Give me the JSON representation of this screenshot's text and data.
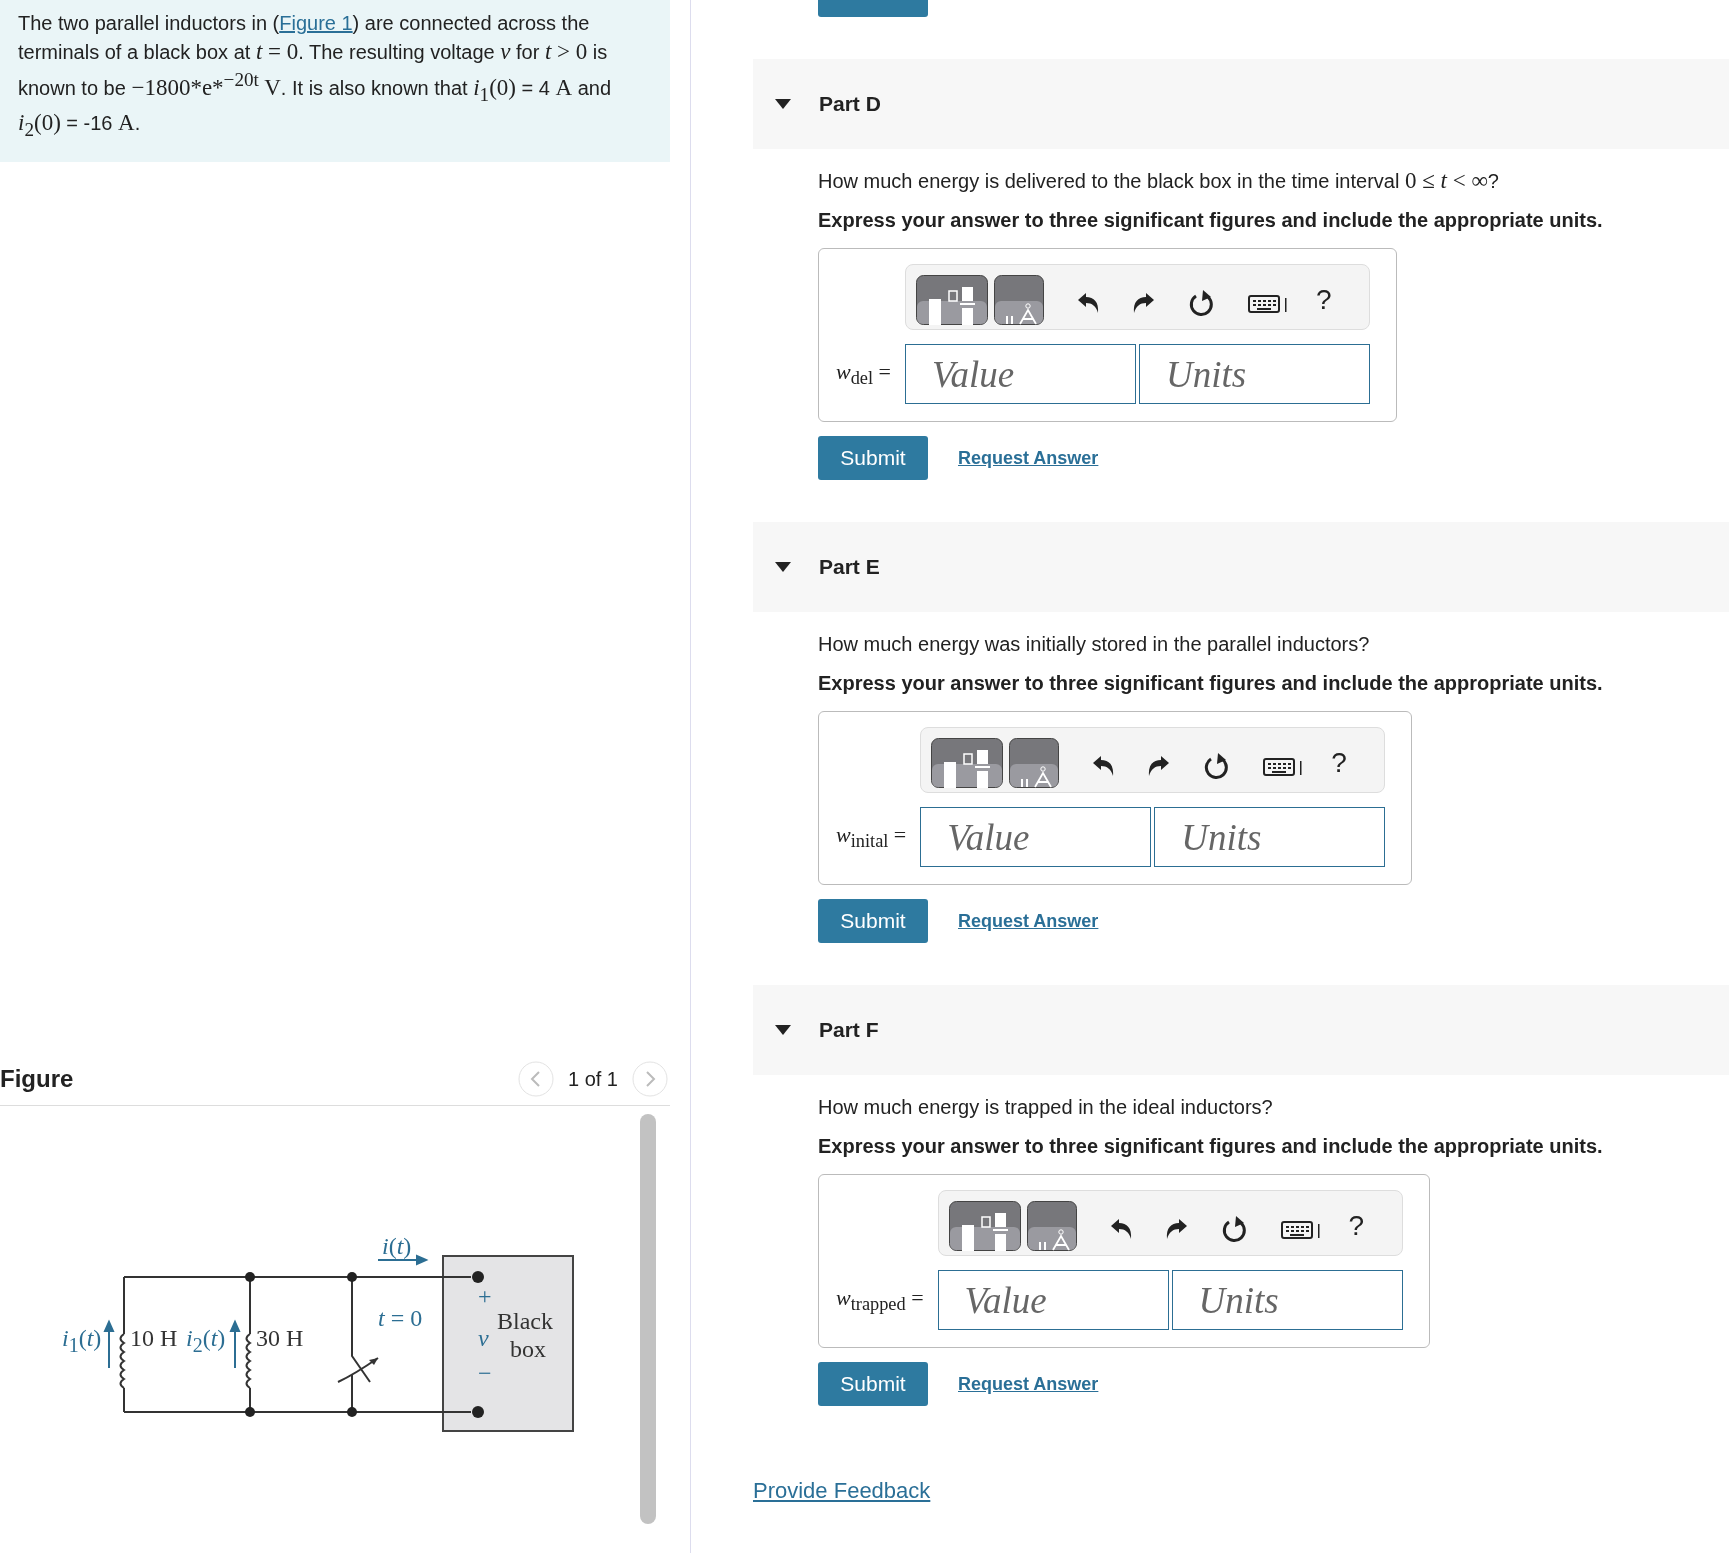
{
  "problem": {
    "segments": [
      {
        "kind": "text",
        "text": "The two parallel inductors in ("
      },
      {
        "kind": "link",
        "text": "Figure 1"
      },
      {
        "kind": "text",
        "text": ") are connected across the terminals of a black box at "
      },
      {
        "kind": "math",
        "text": "*t* = 0"
      },
      {
        "kind": "text",
        "text": ". The resulting voltage "
      },
      {
        "kind": "math",
        "text": "*v*"
      },
      {
        "kind": "text",
        "text": " for "
      },
      {
        "kind": "math",
        "text": "*t* > 0"
      },
      {
        "kind": "text",
        "text": " is known to be "
      },
      {
        "kind": "math",
        "text": "−1800*e*$^{−20t}$ V"
      },
      {
        "kind": "text",
        "text": ". It is also known that "
      },
      {
        "kind": "math",
        "text": "*i*$_{1}$(0)"
      },
      {
        "kind": "text",
        "text": " = 4 "
      },
      {
        "kind": "math",
        "text": "A"
      },
      {
        "kind": "text",
        "text": " and "
      },
      {
        "kind": "math",
        "text": "*i*$_{2}$(0)"
      },
      {
        "kind": "text",
        "text": " = -16 "
      },
      {
        "kind": "math",
        "text": "A"
      },
      {
        "kind": "text",
        "text": "."
      }
    ]
  },
  "figure": {
    "title": "Figure",
    "pager": "1 of 1",
    "labels": [
      {
        "kind": "blue",
        "text": "*i*(*t*)"
      },
      {
        "kind": "blue",
        "text": "*t* = 0"
      },
      {
        "kind": "blue",
        "text": "*i*$_{1}$(*t*)"
      },
      {
        "kind": "dark",
        "text": "10 H"
      },
      {
        "kind": "blue",
        "text": "*i*$_{2}$(*t*)"
      },
      {
        "kind": "dark",
        "text": "30 H"
      },
      {
        "kind": "blue",
        "text": "+"
      },
      {
        "kind": "blue",
        "text": "*v*"
      },
      {
        "kind": "blue",
        "text": "−"
      },
      {
        "kind": "dark",
        "text": "Black"
      },
      {
        "kind": "dark",
        "text": "box"
      }
    ]
  },
  "parts": [
    {
      "title": "Part D",
      "expanded": true,
      "question": [
        {
          "kind": "text",
          "text": "How much energy is delivered to the black box in the time interval "
        },
        {
          "kind": "math",
          "text": "0 ≤ *t* < ∞"
        },
        {
          "kind": "text",
          "text": "?"
        }
      ],
      "instruction": "Express your answer to three significant figures and include the appropriate units.",
      "variable": "*w*$_{del}$ =",
      "value_placeholder": "Value",
      "units_placeholder": "Units",
      "help": "?",
      "submit": "Submit",
      "request": "Request Answer"
    },
    {
      "title": "Part E",
      "expanded": true,
      "question": [
        {
          "kind": "text",
          "text": "How much energy was initially stored in the parallel inductors?"
        }
      ],
      "instruction": "Express your answer to three significant figures and include the appropriate units.",
      "variable": "*w*$_{inital}$ =",
      "value_placeholder": "Value",
      "units_placeholder": "Units",
      "help": "?",
      "submit": "Submit",
      "request": "Request Answer"
    },
    {
      "title": "Part F",
      "expanded": true,
      "question": [
        {
          "kind": "text",
          "text": "How much energy is trapped in the ideal inductors?"
        }
      ],
      "instruction": "Express your answer to three significant figures and include the appropriate units.",
      "variable": "*w*$_{trapped}$ =",
      "value_placeholder": "Value",
      "units_placeholder": "Units",
      "help": "?",
      "submit": "Submit",
      "request": "Request Answer"
    }
  ],
  "feedback": "Provide Feedback"
}
